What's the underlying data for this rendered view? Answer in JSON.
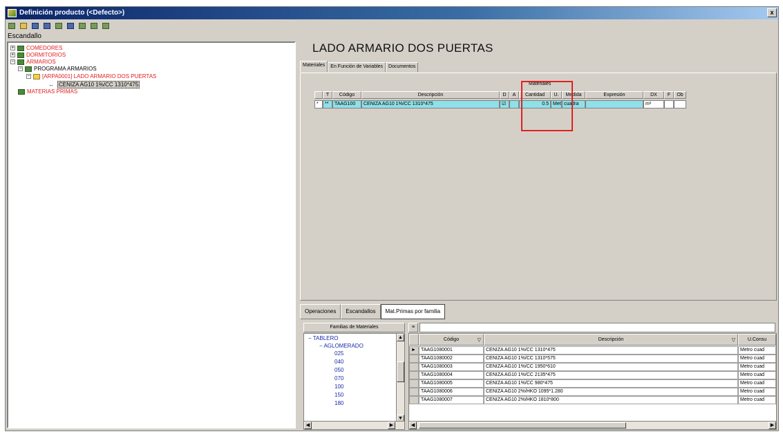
{
  "window": {
    "title": "Definición producto (<Defecto>)",
    "close_label": "x"
  },
  "toolbar": {
    "buttons": [
      "new-icon",
      "open-icon",
      "save-icon",
      "save-as-icon",
      "print-icon",
      "filter-icon",
      "tree-icon",
      "tree-edit-icon",
      "tree-view-icon"
    ]
  },
  "left_panel": {
    "label": "Escandallo",
    "tree": [
      {
        "label": "COMEDORES",
        "level": 0,
        "color": "red"
      },
      {
        "label": "DORMITORIOS",
        "level": 0,
        "color": "red"
      },
      {
        "label": "ARMARIOS",
        "level": 0,
        "color": "red"
      },
      {
        "label": "PROGRAMA ARMARIOS",
        "level": 1,
        "color": "black"
      },
      {
        "label": "[ARPA0001] LADO ARMARIO DOS PUERTAS",
        "level": 2,
        "color": "red"
      },
      {
        "label": "CENIZA AG10 1%/CC 1310*475",
        "level": 3,
        "color": "black"
      },
      {
        "label": "MATERIAS PRIMAS",
        "level": 0,
        "color": "red"
      }
    ]
  },
  "product": {
    "title": "LADO ARMARIO DOS PUERTAS"
  },
  "top_tabs": [
    "Materiales",
    "En Función de Variables",
    "Documentos"
  ],
  "materials": {
    "group_label": "Materiales",
    "columns": [
      "T",
      "Código",
      "Descripción",
      "D",
      "A",
      "Cantidad",
      "U.",
      "Medida",
      "Expresión",
      "DX",
      "F",
      "Ob"
    ],
    "rows": [
      {
        "marker": "*",
        "type": "**",
        "codigo": "TAAG100",
        "descripcion": "CENIZA AG10 1%/CC 1310*475",
        "d": "☑",
        "a": "",
        "cantidad": "0.5",
        "u": "Metro",
        "medida": "cuadra",
        "expresion": "",
        "dx": "m²",
        "f": "",
        "ob": ""
      }
    ]
  },
  "bottom_tabs": [
    "Operaciones",
    "Escandallos",
    "Mat.Primas por familia"
  ],
  "families": {
    "header": "Familias de Materiales",
    "items": [
      {
        "label": "TABLERO",
        "indent": 0,
        "exp": "−"
      },
      {
        "label": "AGLOMERADO",
        "indent": 1,
        "exp": "−"
      },
      {
        "label": "025",
        "indent": 2,
        "exp": ""
      },
      {
        "label": "040",
        "indent": 2,
        "exp": ""
      },
      {
        "label": "050",
        "indent": 2,
        "exp": ""
      },
      {
        "label": "070",
        "indent": 2,
        "exp": ""
      },
      {
        "label": "100",
        "indent": 2,
        "exp": ""
      },
      {
        "label": "150",
        "indent": 2,
        "exp": ""
      },
      {
        "label": "180",
        "indent": 2,
        "exp": ""
      }
    ]
  },
  "raw_materials": {
    "filter_label": "≡",
    "columns": [
      "Código",
      "Descripción",
      "U.Consu"
    ],
    "rows": [
      {
        "codigo": "TAAG1080001",
        "descripcion": "CENIZA AG10 1%/CC 1310*475",
        "unidad": "Metro cuad"
      },
      {
        "codigo": "TAAG1080002",
        "descripcion": "CENIZA AG10 1%/CC 1310*575",
        "unidad": "Metro cuad"
      },
      {
        "codigo": "TAAG1080003",
        "descripcion": "CENIZA AG10 1%/CC 1950*610",
        "unidad": "Metro cuad"
      },
      {
        "codigo": "TAAG1080004",
        "descripcion": "CENIZA AG10 1%/CC 2135*475",
        "unidad": "Metro cuad"
      },
      {
        "codigo": "TAAG1080005",
        "descripcion": "CENIZA AG10 1%/CC 980*475",
        "unidad": "Metro cuad"
      },
      {
        "codigo": "TAAG1080006",
        "descripcion": "CENIZA AG10 2%/HKO 1095*1.280",
        "unidad": "Metro cuad"
      },
      {
        "codigo": "TAAG1080007",
        "descripcion": "CENIZA AG10 2%/HKO 1810*800",
        "unidad": "Metro cuad"
      }
    ]
  }
}
